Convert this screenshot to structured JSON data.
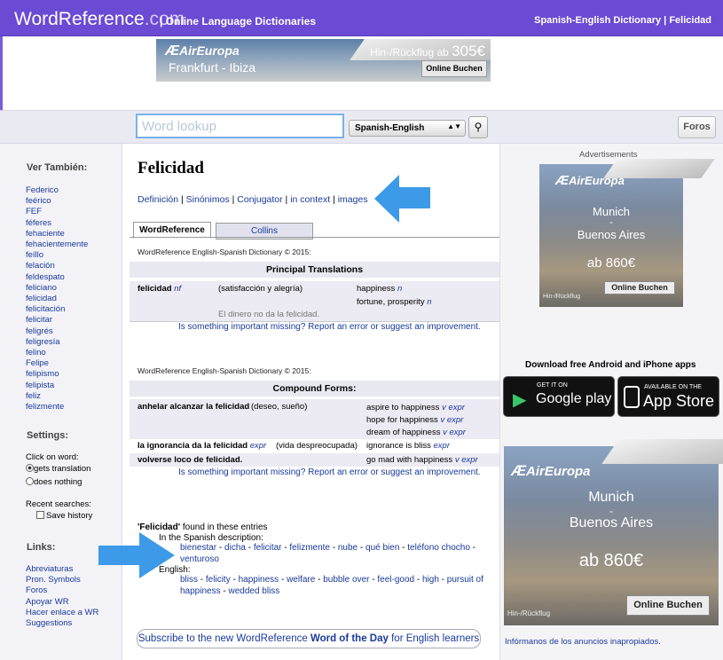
{
  "header": {
    "logo_main": "WordReference",
    "logo_tld": ".com",
    "subtitle": "| Online Language Dictionaries",
    "right_title": "Spanish-English Dictionary | Felicidad"
  },
  "top_ad": {
    "brand": "AirEuropa",
    "route": "Frankfurt - Ibiza",
    "price_prefix": "Hin-/Rückflug ab",
    "price": "305€",
    "button": "Online Buchen"
  },
  "search": {
    "placeholder": "Word lookup",
    "language": "Spanish-English",
    "foros": "Foros"
  },
  "sidebar": {
    "see_also_title": "Ver También:",
    "see_also": [
      "Federico",
      "feérico",
      "FEF",
      "féferes",
      "fehaciente",
      "fehacientemente",
      "feíllo",
      "felación",
      "feldespato",
      "feliciano",
      "felicidad",
      "felicitación",
      "felicitar",
      "feligrés",
      "feligresía",
      "felino",
      "Felipe",
      "felipismo",
      "felipista",
      "feliz",
      "felizmente"
    ],
    "settings_title": "Settings:",
    "click_on_word": "Click on word:",
    "opt_gets": "gets translation",
    "opt_nothing": "does nothing",
    "recent_searches": "Recent searches:",
    "save_history": "Save history",
    "links_title": "Links:",
    "links": [
      "Abreviaturas",
      "Pron. Symbols",
      "Foros",
      "Apoyar WR",
      "Hacer enlace a WR",
      "Suggestions"
    ]
  },
  "main": {
    "word": "Felicidad",
    "nav": [
      "Definición",
      "Sinónimos",
      "Conjugator",
      "in context",
      "images"
    ],
    "tabs": [
      "WordReference",
      "Collins"
    ],
    "dict_heading": "WordReference English-Spanish Dictionary © 2015:",
    "principal_title": "Principal Translations",
    "principal": {
      "term": "felicidad",
      "term_pos": "nf",
      "note": "(satisfacción y alegría)",
      "tr1": "happiness",
      "tr1_pos": "n",
      "tr2": "fortune, prosperity",
      "tr2_pos": "n",
      "example": "El dinero no da la felicidad."
    },
    "report": "Is something important missing? Report an error or suggest an improvement.",
    "compound_title": "Compound Forms:",
    "compound": [
      {
        "term": "anhelar alcanzar la felicidad",
        "term_pos": "",
        "note": "(deseo, sueño)",
        "tr": [
          "aspire to happiness",
          "hope for happiness",
          "dream of happiness"
        ],
        "tr_pos": "v expr"
      },
      {
        "term": "la ignorancia da la felicidad",
        "term_pos": "expr",
        "note": "(vida despreocupada)",
        "tr": [
          "ignorance is bliss"
        ],
        "tr_pos": "expr"
      },
      {
        "term": "volverse loco de felicidad.",
        "term_pos": "",
        "note": "",
        "tr": [
          "go mad with happiness"
        ],
        "tr_pos": "v expr"
      }
    ],
    "found": {
      "word": "'Felicidad'",
      "text": "found in these entries",
      "spanish_label": "In the Spanish description:",
      "spanish_links": [
        "bienestar",
        "dicha",
        "felicitar",
        "felizmente",
        "nube",
        "qué bien",
        "teléfono chocho",
        "venturoso"
      ],
      "english_label": "English:",
      "english_links": [
        "bliss",
        "felicity",
        "happiness",
        "welfare",
        "bubble over",
        "feel-good",
        "high",
        "pursuit of happiness",
        "wedded bliss"
      ]
    },
    "subscribe_pre": "Subscribe to the new WordReference",
    "subscribe_bold": "Word of the Day",
    "subscribe_post": "for English learners"
  },
  "right": {
    "ads_label": "Advertisements",
    "ad2": {
      "brand": "AirEuropa",
      "city1": "Munich",
      "dash": "-",
      "city2": "Buenos Aires",
      "price": "ab 860€",
      "small": "Hin-/Rückflug",
      "button": "Online Buchen"
    },
    "apps_title": "Download free Android and iPhone apps",
    "google_small": "GET IT ON",
    "google_big": "Google play",
    "apple_small": "AVAILABLE ON THE",
    "apple_big": "App Store",
    "ad3": {
      "brand": "AirEuropa",
      "city1": "Munich",
      "dash": "-",
      "city2": "Buenos Aires",
      "price": "ab 860€",
      "small": "Hin-/Rückflug",
      "button": "Online Buchen"
    },
    "inform": "Infórmanos de los anuncios inapropiados."
  }
}
